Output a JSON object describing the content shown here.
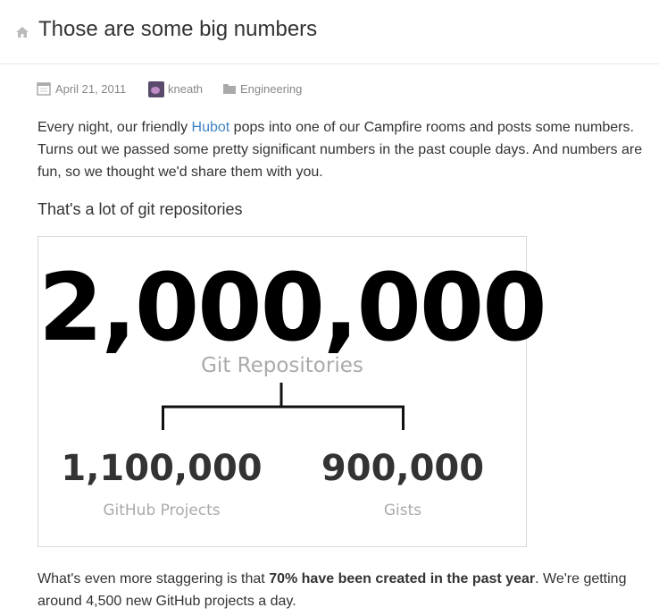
{
  "header": {
    "title": "Those are some big numbers",
    "icon": "home-icon"
  },
  "meta": {
    "date": "April 21, 2011",
    "author": "kneath",
    "category": "Engineering"
  },
  "intro": {
    "before_link": "Every night, our friendly ",
    "link_text": "Hubot",
    "after_link": " pops into one of our Campfire rooms and posts some numbers. Turns out we passed some pretty significant numbers in the past couple days. And numbers are fun, so we thought we'd share them with you."
  },
  "subheading": "That's a lot of git repositories",
  "figure": {
    "total_value": "2,000,000",
    "total_label": "Git Repositories",
    "left_value": "1,100,000",
    "left_label": "GitHub Projects",
    "right_value": "900,000",
    "right_label": "Gists"
  },
  "closing": {
    "before_bold": "What's even more staggering is that ",
    "bold": "70% have been created in the past year",
    "after_bold": ". We're getting around 4,500 new GitHub projects a day."
  },
  "colors": {
    "link": "#4183c4",
    "text": "#333333",
    "muted": "#888888"
  }
}
